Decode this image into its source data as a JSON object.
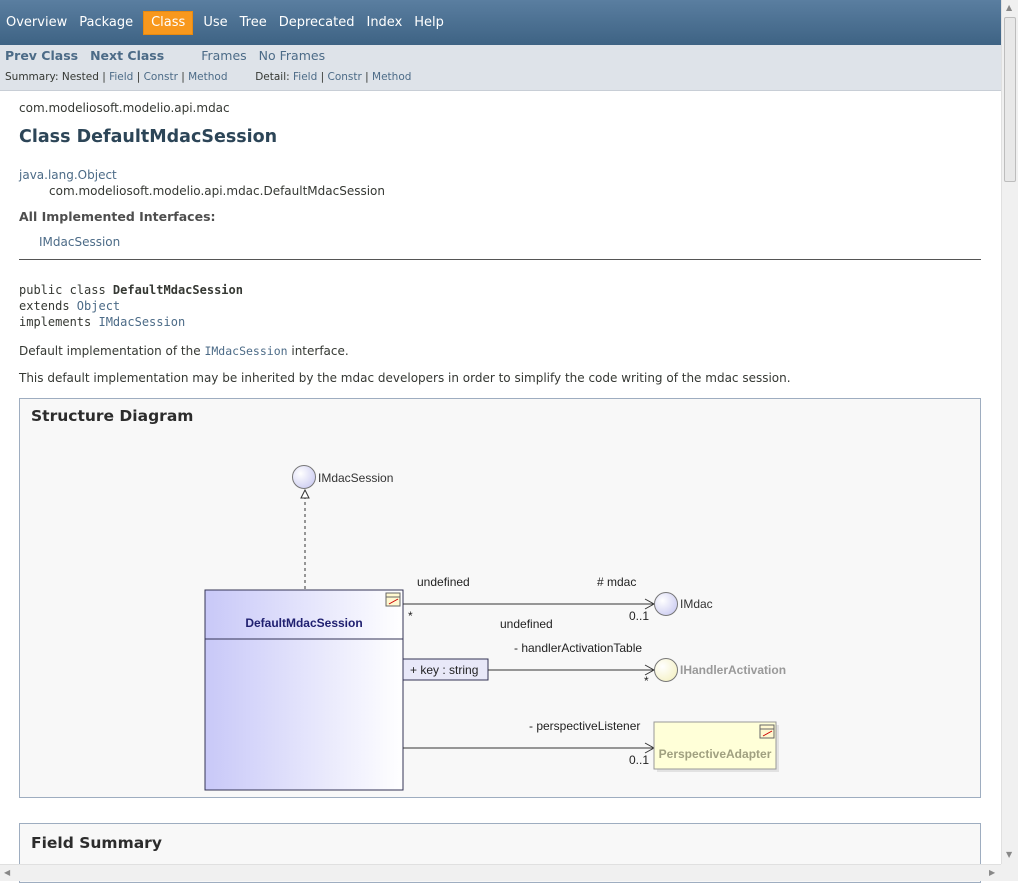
{
  "topnav": {
    "items": [
      "Overview",
      "Package",
      "Class",
      "Use",
      "Tree",
      "Deprecated",
      "Index",
      "Help"
    ],
    "active": "Class"
  },
  "subnav": {
    "prev_class": "Prev Class",
    "next_class": "Next Class",
    "frames": "Frames",
    "no_frames": "No Frames",
    "summary_label": "Summary:",
    "summary_nested": "Nested",
    "summary_field": "Field",
    "summary_constr": "Constr",
    "summary_method": "Method",
    "detail_label": "Detail:",
    "detail_field": "Field",
    "detail_constr": "Constr",
    "detail_method": "Method"
  },
  "header": {
    "package": "com.modeliosoft.modelio.api.mdac",
    "title": "Class DefaultMdacSession",
    "inheritance_root": "java.lang.Object",
    "inheritance_class": "com.modeliosoft.modelio.api.mdac.DefaultMdacSession",
    "interfaces_label": "All Implemented Interfaces:",
    "interfaces_value": "IMdacSession"
  },
  "signature": {
    "line1_prefix": "public class ",
    "line1_name": "DefaultMdacSession",
    "line2_prefix": "extends ",
    "line2_link": "Object",
    "line3_prefix": "implements ",
    "line3_link": "IMdacSession"
  },
  "description": {
    "p1_before": "Default implementation of the ",
    "p1_code": "IMdacSession",
    "p1_after": " interface.",
    "p2": "This default implementation may be inherited by the mdac developers in order to simplify the code writing of the mdac session."
  },
  "diagram": {
    "title": "Structure Diagram",
    "interface_top": "IMdacSession",
    "class_name": "DefaultMdacSession",
    "assoc1_left": "undefined",
    "assoc1_role": "# mdac",
    "assoc1_star": "*",
    "assoc1_mult": "0..1",
    "assoc1_target": "IMdac",
    "assoc2_label": "undefined",
    "assoc2_role": "- handlerActivationTable",
    "assoc2_qualifier": "+ key : string",
    "assoc2_mult": "*",
    "assoc2_target": "IHandlerActivation",
    "assoc3_role": "- perspectiveListener",
    "assoc3_mult": "0..1",
    "assoc3_target": "PerspectiveAdapter"
  },
  "field_summary": {
    "title": "Field Summary"
  },
  "colors": {
    "nav_bar": "#4d6f91",
    "active_tab": "#f8981d",
    "subnav_bg": "#dee3e9",
    "link": "#4c6b87",
    "class_box": "#d2d2fa",
    "adapter_box": "#ffffd2"
  }
}
